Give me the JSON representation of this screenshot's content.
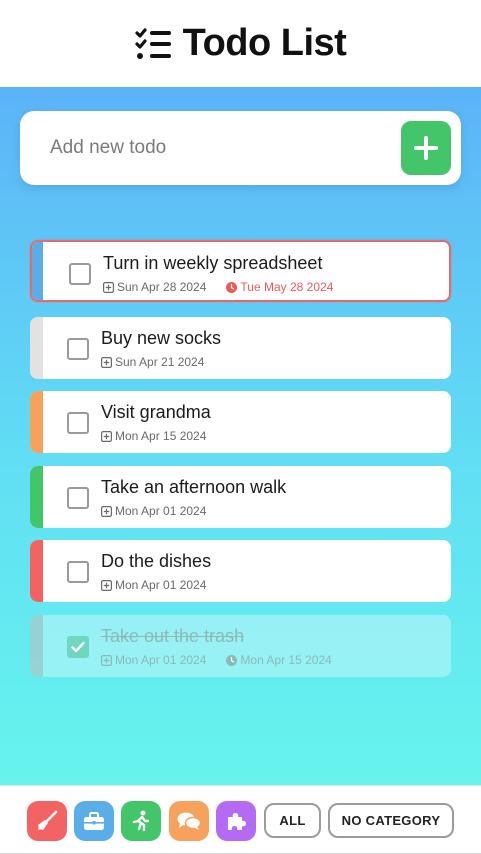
{
  "header": {
    "title": "Todo List",
    "icon": "checklist-icon"
  },
  "add_todo": {
    "placeholder": "Add new todo",
    "button_icon": "plus-icon",
    "button_color": "#43c56a"
  },
  "todos": [
    {
      "text": "Turn in weekly spreadsheet",
      "created": "Sun Apr 28 2024",
      "due": "Tue May 28 2024",
      "color": "#5aaee8",
      "done": false,
      "overdue": true
    },
    {
      "text": "Buy new socks",
      "created": "Sun Apr 21 2024",
      "color": "#e2e2e2",
      "done": false
    },
    {
      "text": "Visit grandma",
      "created": "Mon Apr 15 2024",
      "color": "#f6a25c",
      "done": false
    },
    {
      "text": "Take an afternoon walk",
      "created": "Mon Apr 01 2024",
      "color": "#43c56a",
      "done": false
    },
    {
      "text": "Do the dishes",
      "created": "Mon Apr 01 2024",
      "color": "#f46363",
      "done": false
    },
    {
      "text": "Take out the trash",
      "created": "Mon Apr 01 2024",
      "due": "Mon Apr 15 2024",
      "color": "#9cc3c3",
      "done": true
    }
  ],
  "filters": {
    "categories": [
      {
        "icon": "broom-icon",
        "color": "#f46363"
      },
      {
        "icon": "briefcase-icon",
        "color": "#5aaee8"
      },
      {
        "icon": "running-icon",
        "color": "#43c56a"
      },
      {
        "icon": "chat-bubbles-icon",
        "color": "#f6a25c"
      },
      {
        "icon": "puzzle-icon",
        "color": "#b56af5"
      }
    ],
    "all_label": "ALL",
    "no_category_label": "NO CATEGORY"
  },
  "colors": {
    "overdue": "#ee5a5a",
    "accent_green": "#43c56a"
  }
}
